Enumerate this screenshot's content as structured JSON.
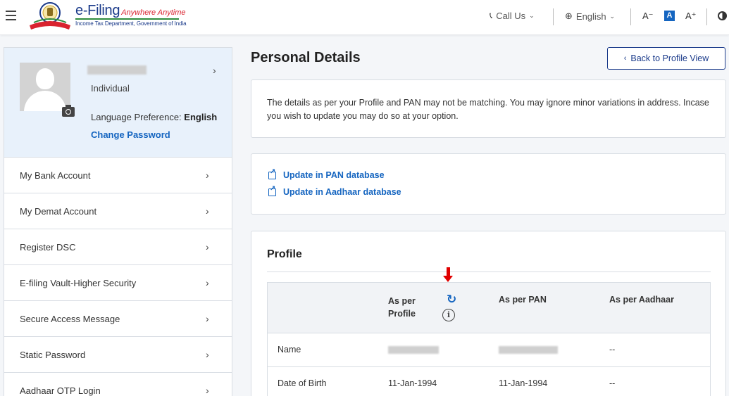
{
  "header": {
    "logo_title": "e-Filing",
    "logo_tagline": "Anywhere Anytime",
    "logo_subtitle": "Income Tax Department, Government of India",
    "call_us": "Call Us",
    "language": "English",
    "font_decrease": "A⁻",
    "font_normal": "A",
    "font_increase": "A⁺"
  },
  "sidebar": {
    "user_type": "Individual",
    "language_pref_label": "Language Preference: ",
    "language_pref_value": "English",
    "change_password": "Change Password",
    "items": [
      {
        "label": "My Bank Account"
      },
      {
        "label": "My Demat Account"
      },
      {
        "label": "Register DSC"
      },
      {
        "label": "E-filing Vault-Higher Security"
      },
      {
        "label": "Secure Access Message"
      },
      {
        "label": "Static Password"
      },
      {
        "label": "Aadhaar OTP Login"
      }
    ]
  },
  "main": {
    "page_title": "Personal Details",
    "back_button": "Back to Profile View",
    "notice_text": "The details as per your Profile and PAN may not be matching. You may ignore minor variations in address. Incase you wish to update you may do so at your option.",
    "links": [
      {
        "label": "Update in PAN database"
      },
      {
        "label": "Update in Aadhaar database"
      }
    ],
    "profile_heading": "Profile",
    "table": {
      "col_profile_line1": "As per",
      "col_profile_line2": "Profile",
      "col_pan": "As per PAN",
      "col_aadhaar": "As per Aadhaar",
      "rows": [
        {
          "field": "Name",
          "profile": "",
          "pan": "",
          "aadhaar": "--"
        },
        {
          "field": "Date of Birth",
          "profile": "11-Jan-1994",
          "pan": "11-Jan-1994",
          "aadhaar": "--"
        }
      ]
    }
  },
  "colors": {
    "brand_blue": "#1a3a8a",
    "link_blue": "#1565c0",
    "annotation_red": "#e00000"
  }
}
